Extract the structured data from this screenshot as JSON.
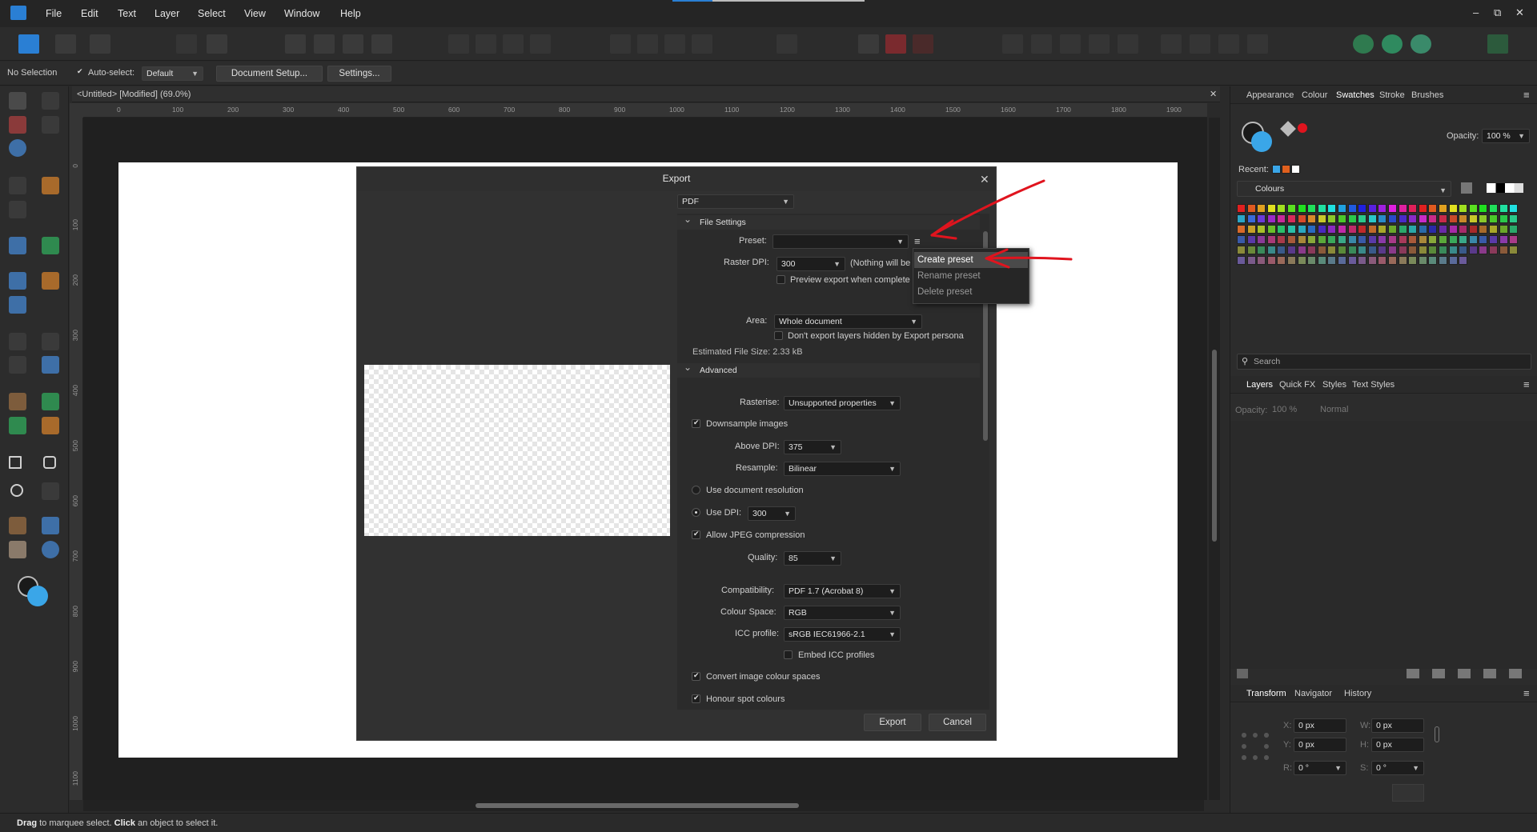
{
  "menubar": {
    "items": [
      "File",
      "Edit",
      "Text",
      "Layer",
      "Select",
      "View",
      "Window",
      "Help"
    ],
    "controls": {
      "minimize": "‒",
      "restore": "⧉",
      "close": "✕"
    }
  },
  "context_toolbar": {
    "selection": "No Selection",
    "auto_select_label": "Auto-select:",
    "auto_select_value": "Default",
    "document_setup": "Document Setup...",
    "settings": "Settings..."
  },
  "document": {
    "tab_title": "<Untitled> [Modified] (69.0%)",
    "close": "✕",
    "ruler_h": [
      "0",
      "100",
      "200",
      "300",
      "400",
      "500",
      "600",
      "700",
      "800",
      "900",
      "1000",
      "1100",
      "1200",
      "1300",
      "1400",
      "1500",
      "1600",
      "1700",
      "1800",
      "1900"
    ],
    "ruler_v": [
      "0",
      "100",
      "200",
      "300",
      "400",
      "500",
      "600",
      "700",
      "800",
      "900",
      "1000",
      "1100"
    ]
  },
  "status": {
    "drag": "Drag",
    "drag_text": " to marquee select. ",
    "click": "Click",
    "click_text": " an object to select it."
  },
  "export_dialog": {
    "title": "Export",
    "close": "✕",
    "format": "PDF",
    "file_settings": {
      "header": "File Settings",
      "preset_label": "Preset:",
      "preset_value": "",
      "raster_dpi_label": "Raster DPI:",
      "raster_dpi_value": "300",
      "raster_note": "(Nothing will be",
      "preview_export": "Preview export when complete",
      "area_label": "Area:",
      "area_value": "Whole document",
      "dont_export_hidden": "Don't export layers hidden by Export persona",
      "estimated_size": "Estimated File Size: 2.33 kB"
    },
    "advanced": {
      "header": "Advanced",
      "rasterise_label": "Rasterise:",
      "rasterise_value": "Unsupported properties",
      "downsample": "Downsample images",
      "above_dpi_label": "Above DPI:",
      "above_dpi_value": "375",
      "resample_label": "Resample:",
      "resample_value": "Bilinear",
      "use_doc_res": "Use document resolution",
      "use_dpi_label": "Use DPI:",
      "use_dpi_value": "300",
      "allow_jpeg": "Allow JPEG compression",
      "quality_label": "Quality:",
      "quality_value": "85",
      "compat_label": "Compatibility:",
      "compat_value": "PDF 1.7 (Acrobat 8)",
      "colour_space_label": "Colour Space:",
      "colour_space_value": "RGB",
      "icc_label": "ICC profile:",
      "icc_value": "sRGB IEC61966-2.1",
      "embed_icc": "Embed ICC profiles",
      "convert_colour": "Convert image colour spaces",
      "honour_spot": "Honour spot colours"
    },
    "preset_menu": [
      "Create preset",
      "Rename preset",
      "Delete preset"
    ],
    "export_button": "Export",
    "cancel_button": "Cancel"
  },
  "swatches_panel": {
    "tabs": [
      "Appearance",
      "Colour",
      "Swatches",
      "Stroke",
      "Brushes"
    ],
    "active_tab": "Swatches",
    "opacity_label": "Opacity:",
    "opacity_value": "100 %",
    "recent_label": "Recent:",
    "palette": "Colours",
    "search_placeholder": "Search"
  },
  "layers_panel": {
    "tabs": [
      "Layers",
      "Quick FX",
      "Styles",
      "Text Styles"
    ],
    "opacity_label": "Opacity:",
    "opacity_value": "100 %",
    "blend": "Normal"
  },
  "transform_panel": {
    "tabs": [
      "Transform",
      "Navigator",
      "History"
    ],
    "x_label": "X:",
    "x_value": "0 px",
    "y_label": "Y:",
    "y_value": "0 px",
    "w_label": "W:",
    "w_value": "0 px",
    "h_label": "H:",
    "h_value": "0 px",
    "r_label": "R:",
    "r_value": "0 °",
    "s_label": "S:",
    "s_value": "0 °"
  },
  "colors": {
    "accent": "#2a7fd4",
    "annotation": "#e0141e",
    "fill_blue": "#3aa6e8"
  }
}
